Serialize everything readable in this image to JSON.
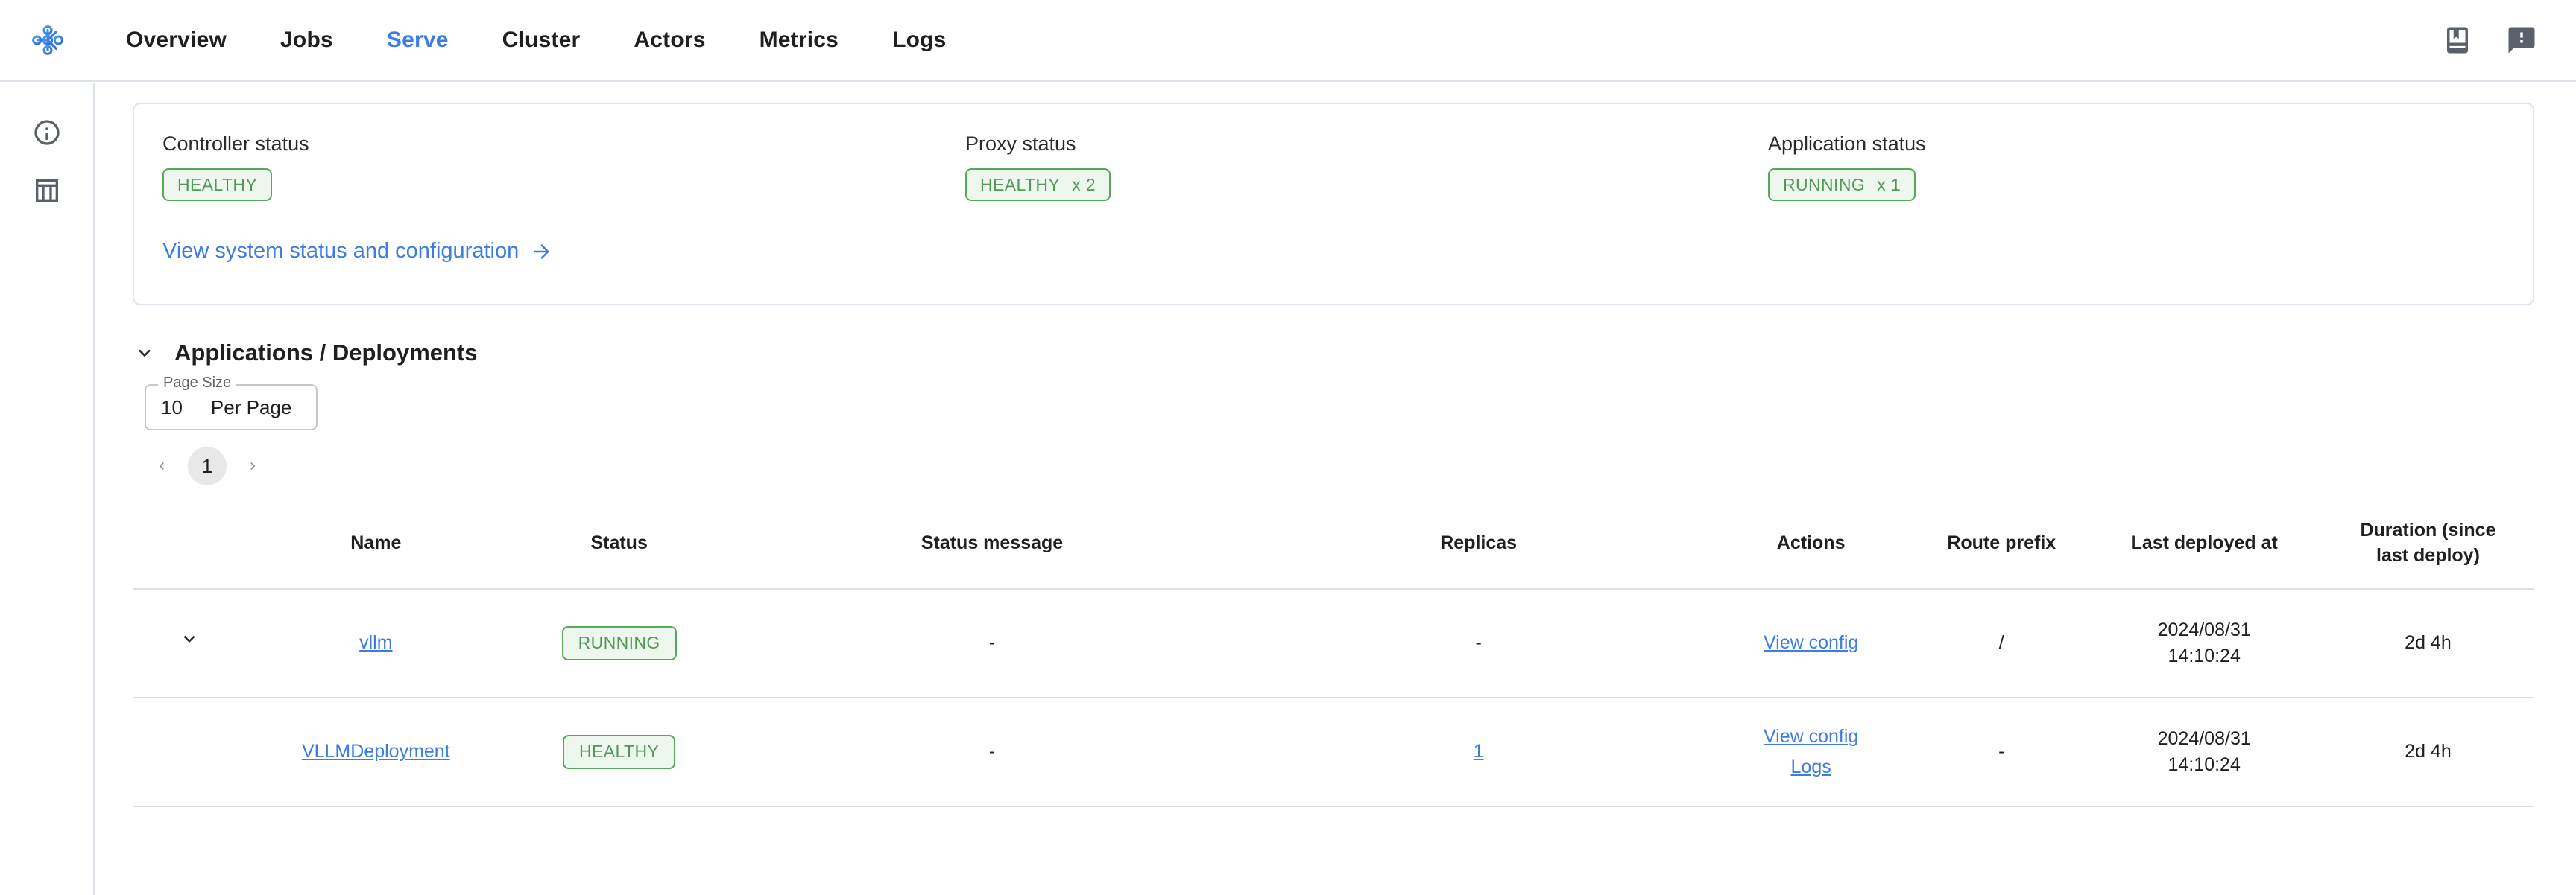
{
  "brand": {
    "logo_icon": "ray-graph-logo"
  },
  "nav": {
    "items": [
      {
        "label": "Overview",
        "active": false
      },
      {
        "label": "Jobs",
        "active": false
      },
      {
        "label": "Serve",
        "active": true
      },
      {
        "label": "Cluster",
        "active": false
      },
      {
        "label": "Actors",
        "active": false
      },
      {
        "label": "Metrics",
        "active": false
      },
      {
        "label": "Logs",
        "active": false
      }
    ],
    "right_icons": [
      "book-icon",
      "feedback-icon"
    ]
  },
  "rail": {
    "icons": [
      "info-icon",
      "table-view-icon"
    ]
  },
  "status_card": {
    "columns": [
      {
        "label": "Controller status",
        "chip": "HEALTHY",
        "count": ""
      },
      {
        "label": "Proxy status",
        "chip": "HEALTHY",
        "count": "x 2"
      },
      {
        "label": "Application status",
        "chip": "RUNNING",
        "count": "x 1"
      }
    ],
    "system_link": "View system status and configuration"
  },
  "section": {
    "title": "Applications / Deployments",
    "collapse_icon": "chevron-down-icon"
  },
  "page_size": {
    "legend": "Page Size",
    "value": "10",
    "unit": "Per Page"
  },
  "pagination": {
    "prev_icon": "chevron-left-icon",
    "current": "1",
    "next_icon": "chevron-right-icon"
  },
  "table": {
    "headers": [
      "",
      "Name",
      "Status",
      "Status message",
      "Replicas",
      "Actions",
      "Route prefix",
      "Last deployed at",
      "Duration (since last deploy)"
    ],
    "header_duration_line1": "Duration (since",
    "header_duration_line2": "last deploy)",
    "rows": [
      {
        "expandable": true,
        "expand_icon": "chevron-down-icon",
        "name": "vllm",
        "name_is_link": true,
        "status": "RUNNING",
        "status_message": "-",
        "replicas": "-",
        "replicas_is_link": false,
        "actions": [
          "View config"
        ],
        "route_prefix": "/",
        "last_deployed_date": "2024/08/31",
        "last_deployed_time": "14:10:24",
        "duration": "2d 4h"
      },
      {
        "expandable": false,
        "expand_icon": "",
        "name": "VLLMDeployment",
        "name_is_link": true,
        "status": "HEALTHY",
        "status_message": "-",
        "replicas": "1",
        "replicas_is_link": true,
        "actions": [
          "View config",
          "Logs"
        ],
        "route_prefix": "-",
        "last_deployed_date": "2024/08/31",
        "last_deployed_time": "14:10:24",
        "duration": "2d 4h"
      }
    ]
  },
  "colors": {
    "accent_blue": "#3d7ce0",
    "status_green_text": "#53985a",
    "status_green_border": "#57a957",
    "status_green_bg": "#edf7ed",
    "border_gray": "#e0e0e0"
  }
}
